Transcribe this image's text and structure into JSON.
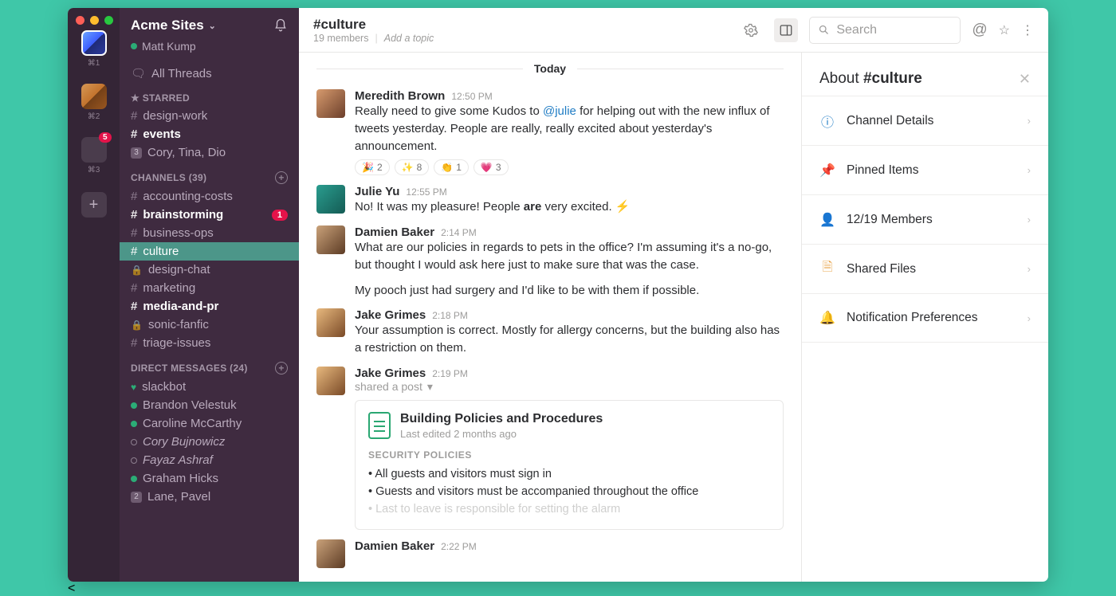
{
  "workspace": {
    "items": [
      {
        "kbd": "⌘1",
        "badge": null
      },
      {
        "kbd": "⌘2",
        "badge": null
      },
      {
        "kbd": "⌘3",
        "badge": "5"
      }
    ]
  },
  "sidebar": {
    "team": "Acme Sites",
    "user": "Matt Kump",
    "all_threads": "All Threads",
    "sections": {
      "starred": {
        "label": "STARRED",
        "items": [
          {
            "icon": "#",
            "label": "design-work",
            "bold": false
          },
          {
            "icon": "#",
            "label": "events",
            "bold": true
          },
          {
            "icon": "sq",
            "label": "Cory, Tina, Dio",
            "bold": false,
            "sq": "3"
          }
        ]
      },
      "channels": {
        "label": "CHANNELS",
        "count": "(39)",
        "items": [
          {
            "icon": "#",
            "label": "accounting-costs"
          },
          {
            "icon": "#",
            "label": "brainstorming",
            "bold": true,
            "badge": "1"
          },
          {
            "icon": "#",
            "label": "business-ops"
          },
          {
            "icon": "#",
            "label": "culture",
            "active": true
          },
          {
            "icon": "lock",
            "label": "design-chat"
          },
          {
            "icon": "#",
            "label": "marketing"
          },
          {
            "icon": "#",
            "label": "media-and-pr",
            "bold": true
          },
          {
            "icon": "lock",
            "label": "sonic-fanfic"
          },
          {
            "icon": "#",
            "label": "triage-issues"
          }
        ]
      },
      "dms": {
        "label": "DIRECT MESSAGES",
        "count": "(24)",
        "items": [
          {
            "presence": "heart",
            "label": "slackbot"
          },
          {
            "presence": "online",
            "label": "Brandon Velestuk"
          },
          {
            "presence": "online",
            "label": "Caroline McCarthy"
          },
          {
            "presence": "away",
            "label": "Cory Bujnowicz",
            "italic": true
          },
          {
            "presence": "away",
            "label": "Fayaz Ashraf",
            "italic": true
          },
          {
            "presence": "online",
            "label": "Graham Hicks"
          },
          {
            "presence": "sq",
            "label": "Lane, Pavel",
            "sq": "2"
          }
        ]
      }
    }
  },
  "header": {
    "channel": "#culture",
    "members": "19 members",
    "topic_placeholder": "Add a topic",
    "search_placeholder": "Search"
  },
  "date_separator": "Today",
  "messages": [
    {
      "name": "Meredith Brown",
      "time": "12:50 PM",
      "avatar": "av1",
      "text_pre": "Really need to give some Kudos to ",
      "mention": "@julie",
      "text_post": " for helping out with the new influx of tweets yesterday. People are really, really excited about yesterday's announcement.",
      "reactions": [
        {
          "e": "🎉",
          "n": "2"
        },
        {
          "e": "✨",
          "n": "8"
        },
        {
          "e": "👏",
          "n": "1"
        },
        {
          "e": "💗",
          "n": "3"
        }
      ]
    },
    {
      "name": "Julie Yu",
      "time": "12:55 PM",
      "avatar": "av2",
      "text_pre": "No! It was my pleasure! People ",
      "strong": "are",
      "text_post": " very excited. ⚡"
    },
    {
      "name": "Damien Baker",
      "time": "2:14 PM",
      "avatar": "av3",
      "text": "What are our policies in regards to pets in the office? I'm assuming it's a no-go, but thought I would ask here just to make sure that was the case.",
      "text2": "My pooch just had surgery and I'd like to be with them if possible."
    },
    {
      "name": "Jake Grimes",
      "time": "2:18 PM",
      "avatar": "av4",
      "text": "Your assumption is correct. Mostly for allergy concerns, but the building also has a restriction on them."
    },
    {
      "name": "Jake Grimes",
      "time": "2:19 PM",
      "avatar": "av4",
      "action": "shared a post",
      "attachment": {
        "title": "Building Policies and Procedures",
        "meta": "Last edited 2 months ago",
        "section": "SECURITY POLICIES",
        "bullets": [
          "All guests and visitors must sign in",
          "Guests and visitors must be accompanied throughout the office",
          "Last to leave is responsible for setting the alarm"
        ]
      }
    },
    {
      "name": "Damien Baker",
      "time": "2:22 PM",
      "avatar": "av3"
    }
  ],
  "panel": {
    "title_pre": "About ",
    "title_bold": "#culture",
    "rows": [
      {
        "icon": "info",
        "label": "Channel Details",
        "color": "#1f7cc4"
      },
      {
        "icon": "pin",
        "label": "Pinned Items",
        "color": "#e5134a"
      },
      {
        "icon": "person",
        "label": "12/19 Members",
        "color": "#2aa772"
      },
      {
        "icon": "file",
        "label": "Shared Files",
        "color": "#e8a44a"
      },
      {
        "icon": "bell",
        "label": "Notification Preferences",
        "color": "#e5134a"
      }
    ]
  }
}
